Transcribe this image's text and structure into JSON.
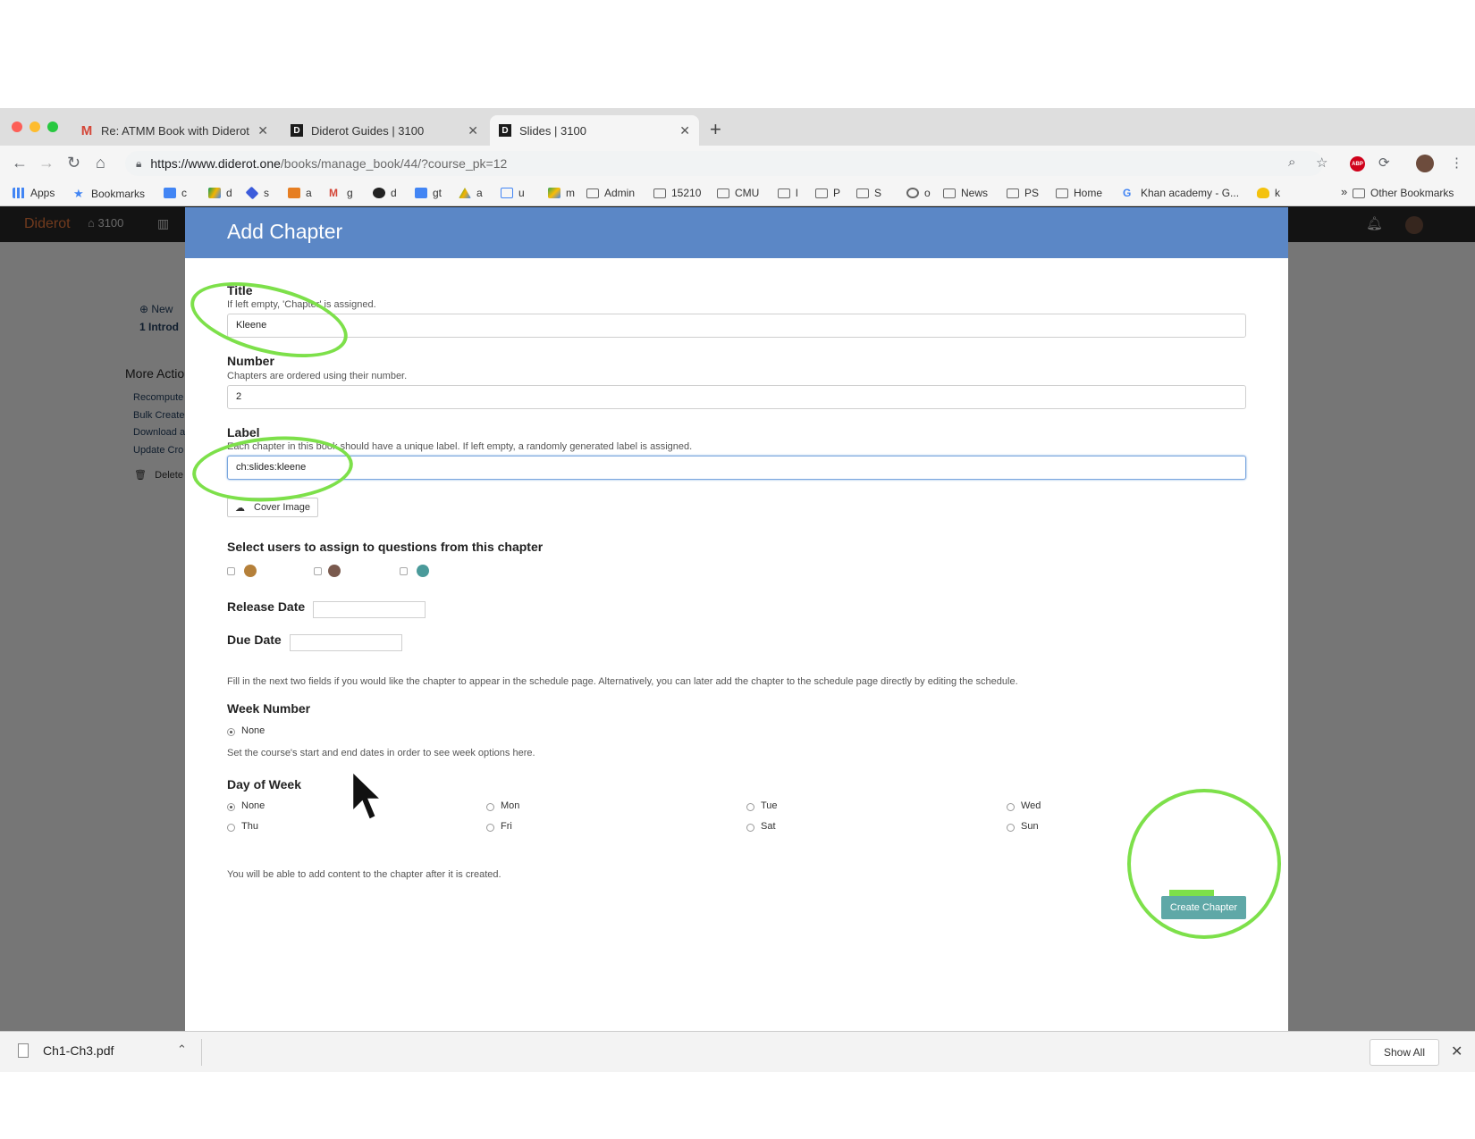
{
  "browser": {
    "tabs": [
      {
        "title": "Re: ATMM Book with Diderot -",
        "favicon": "gmail-icon"
      },
      {
        "title": "Diderot Guides | 3100",
        "favicon": "diderot-icon"
      },
      {
        "title": "Slides | 3100",
        "favicon": "diderot-icon",
        "active": true
      }
    ],
    "url_host": "https://www.diderot.one",
    "url_path": "/books/manage_book/44/?course_pk=12",
    "bookmarks": [
      {
        "label": "Apps",
        "icon": "apps-grid-icon"
      },
      {
        "label": "Bookmarks",
        "icon": "star-icon"
      },
      {
        "label": "c",
        "icon": "calendar-icon"
      },
      {
        "label": "d",
        "icon": "drive-icon"
      },
      {
        "label": "s",
        "icon": "stack-icon"
      },
      {
        "label": "a",
        "icon": "box-icon"
      },
      {
        "label": "g",
        "icon": "gmail-icon"
      },
      {
        "label": "d",
        "icon": "github-icon"
      },
      {
        "label": "gt",
        "icon": "translate-icon"
      },
      {
        "label": "a",
        "icon": "drive-triangle-icon"
      },
      {
        "label": "u",
        "icon": "table-icon"
      },
      {
        "label": "m",
        "icon": "maps-icon"
      },
      {
        "label": "Admin",
        "icon": "folder-icon"
      },
      {
        "label": "15210",
        "icon": "folder-icon"
      },
      {
        "label": "CMU",
        "icon": "folder-icon"
      },
      {
        "label": "l",
        "icon": "folder-icon"
      },
      {
        "label": "P",
        "icon": "folder-icon"
      },
      {
        "label": "S",
        "icon": "folder-icon"
      },
      {
        "label": "o",
        "icon": "gear-icon"
      },
      {
        "label": "News",
        "icon": "folder-icon"
      },
      {
        "label": "PS",
        "icon": "folder-icon"
      },
      {
        "label": "Home",
        "icon": "folder-icon"
      },
      {
        "label": "Khan academy - G...",
        "icon": "google-icon"
      },
      {
        "label": "k",
        "icon": "bulb-icon"
      }
    ],
    "bookmarks_overflow": "»",
    "other_bookmarks": "Other Bookmarks"
  },
  "app": {
    "brand": "Diderot",
    "course": "3100",
    "bg_links": [
      "New",
      "1  Introd"
    ],
    "more_actions": "More Actio",
    "bg_actions": [
      "Recompute",
      "Bulk Create",
      "Download a",
      "Update Cro",
      "Delete"
    ]
  },
  "modal": {
    "title": "Add Chapter",
    "title_field": {
      "label": "Title",
      "help": "If left empty, 'Chapter' is assigned.",
      "value": "Kleene"
    },
    "number_field": {
      "label": "Number",
      "help": "Chapters are ordered using their number.",
      "value": "2"
    },
    "label_field": {
      "label": "Label",
      "help": "Each chapter in this book should have a unique label. If left empty, a randomly generated label is assigned.",
      "value": "ch:slides:kleene"
    },
    "cover_image": "Cover Image",
    "assign_users": "Select users to assign to questions from this chapter",
    "release_date": "Release Date",
    "due_date": "Due Date",
    "schedule_note": "Fill in the next two fields if you would like the chapter to appear in the schedule page. Alternatively, you can later add the chapter to the schedule page directly by editing the schedule.",
    "week_number": {
      "label": "Week Number",
      "option": "None",
      "help": "Set the course's start and end dates in order to see week options here."
    },
    "day_of_week": {
      "label": "Day of Week",
      "options": [
        "None",
        "Mon",
        "Tue",
        "Wed",
        "Thu",
        "Fri",
        "Sat",
        "Sun"
      ],
      "selected": "None"
    },
    "footer_note": "You will be able to add content to the chapter after it is created.",
    "create_button": "Create Chapter",
    "accent_color": "#5b87c6",
    "button_color": "#5fa8a7",
    "annotation_color": "#7de04a"
  },
  "download": {
    "file": "Ch1-Ch3.pdf",
    "show_all": "Show All"
  }
}
